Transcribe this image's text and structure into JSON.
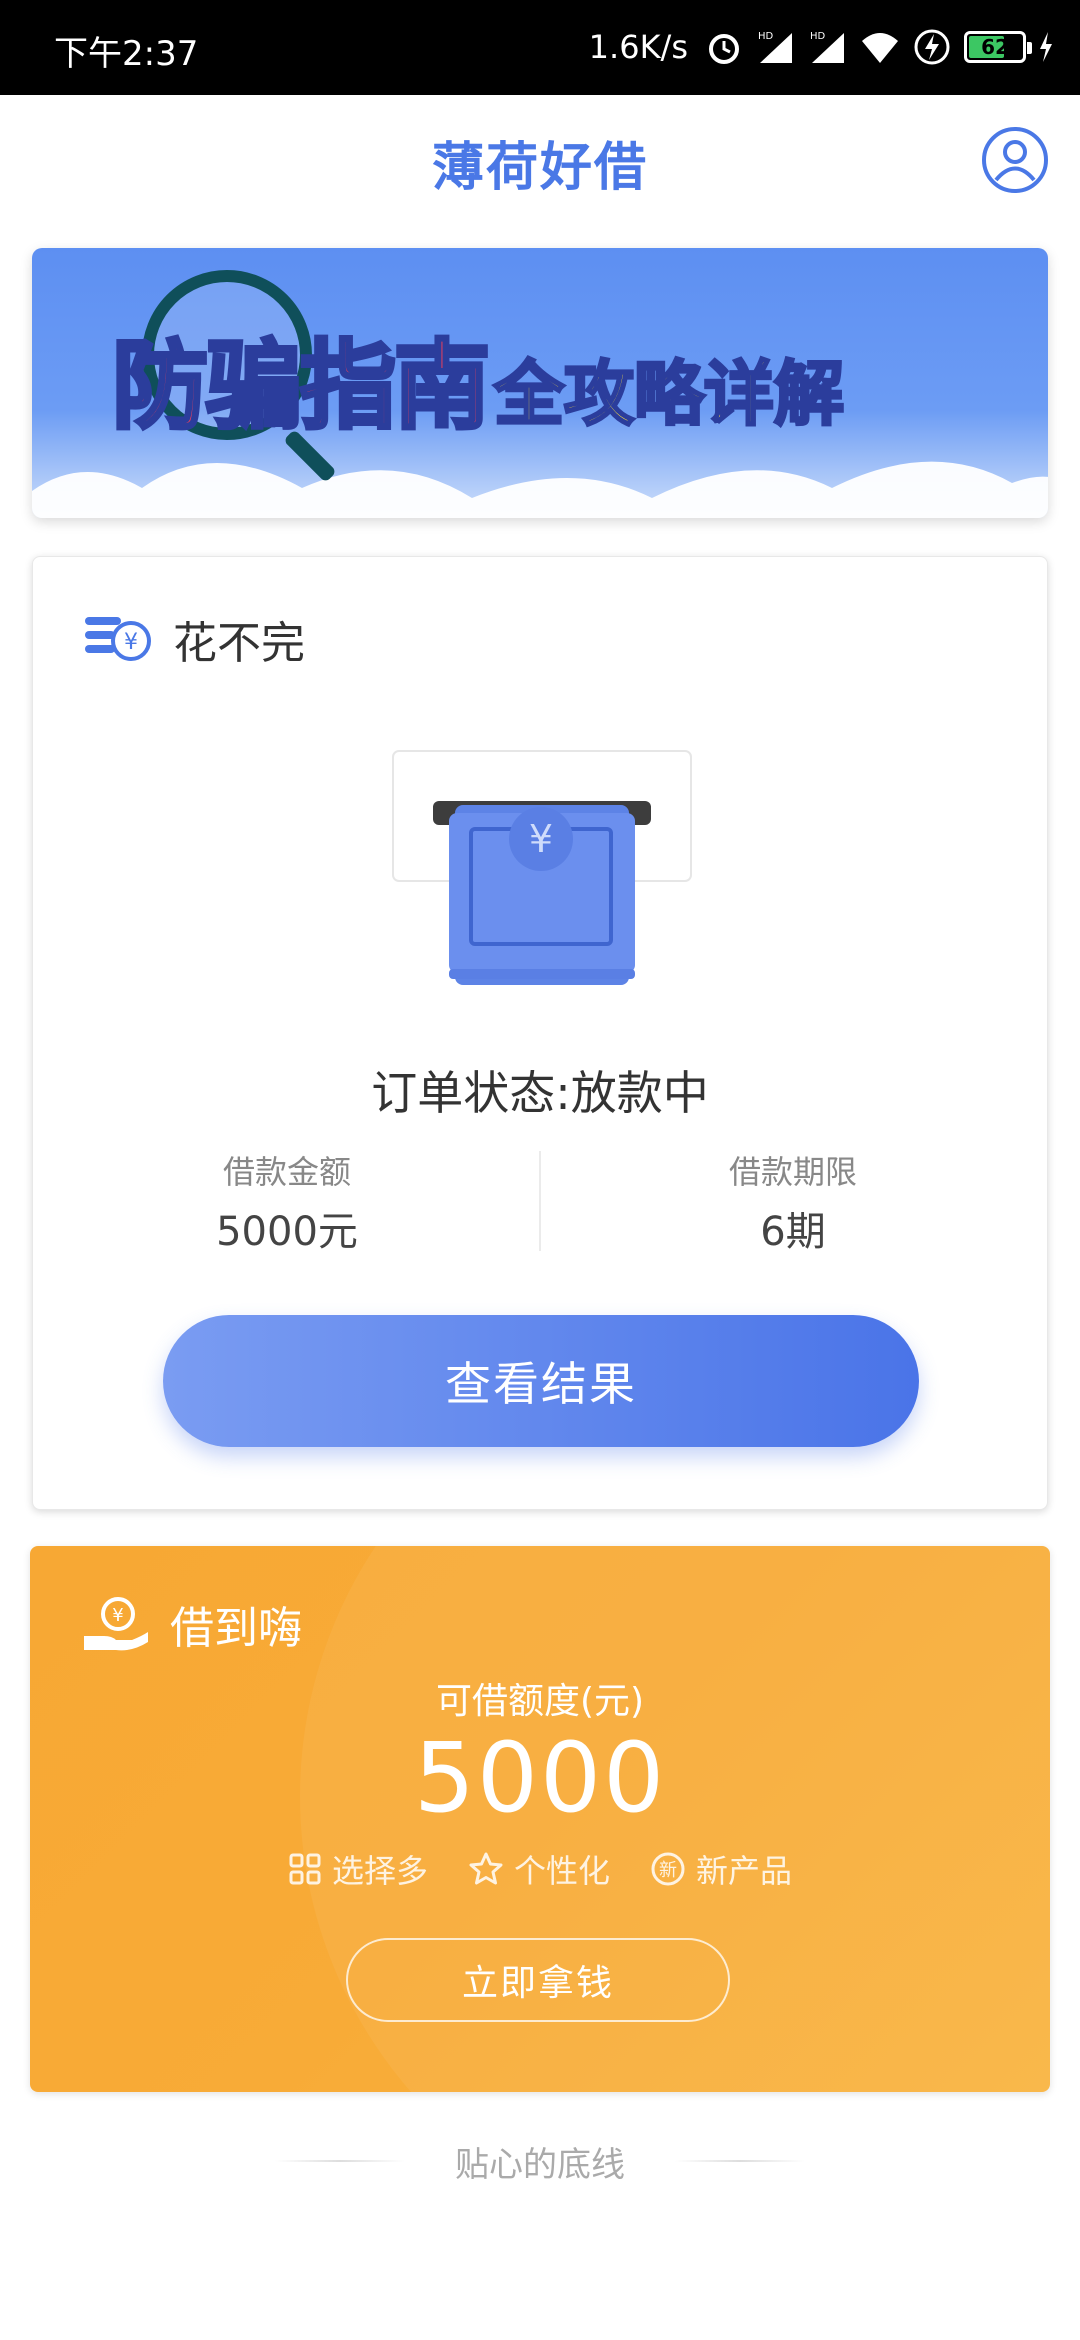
{
  "status_bar": {
    "time": "下午2:37",
    "net_speed": "1.6K/s",
    "battery": "62",
    "icons": [
      "alarm-icon",
      "signal-hd-icon",
      "signal-hd-icon",
      "wifi-icon",
      "charging-icon",
      "battery-icon"
    ]
  },
  "header": {
    "title": "薄荷好借",
    "profile_icon": "user-profile-icon",
    "accent_color": "#4a78e6"
  },
  "banner": {
    "line1": "防骗指南",
    "line2": "全攻略详解"
  },
  "card1": {
    "product_name": "花不完",
    "product_icon": "coin-stack-icon",
    "illustration": "atm-cash-icon",
    "order_status": "订单状态:放款中",
    "amount_label": "借款金额",
    "amount_value": "5000元",
    "term_label": "借款期限",
    "term_value": "6期",
    "result_button": "查看结果"
  },
  "card2": {
    "product_name": "借到嗨",
    "product_icon": "hand-coin-icon",
    "limit_label": "可借额度(元)",
    "limit_value": "5000",
    "features": [
      {
        "icon": "grid-icon",
        "label": "选择多"
      },
      {
        "icon": "star-icon",
        "label": "个性化"
      },
      {
        "icon": "new-badge-icon",
        "label": "新产品"
      }
    ],
    "get_button": "立即拿钱",
    "accent_color": "#f8ab37"
  },
  "footer": {
    "text": "贴心的底线"
  }
}
